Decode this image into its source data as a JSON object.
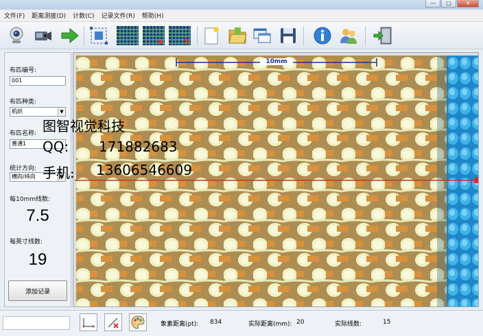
{
  "menu": [
    "文件(F)",
    "距离测度(D)",
    "计数(C)",
    "记录文件(R)",
    "帮助(H)"
  ],
  "window_buttons": {
    "minimize": "—",
    "maximize": "□",
    "close": "×"
  },
  "left": {
    "cloth_no_label": "布匹编号:",
    "cloth_no_value": "001",
    "cloth_type_label": "布匹种类:",
    "cloth_type_value": "机织",
    "cloth_name_label": "布匹名称:",
    "cloth_name_value": "普通1",
    "direction_label": "统计方向:",
    "direction_value": "横向/纬向",
    "per10mm_label": "每10mm线数:",
    "per10mm_value": "7.5",
    "perinch_label": "每英寸线数:",
    "perinch_value": "19",
    "add_record": "添加记录"
  },
  "image": {
    "scale_label": "10mm",
    "overlay_line1": "图智视觉科技",
    "overlay_line2_label": "QQ:",
    "overlay_line2_value": "171882683",
    "overlay_line3_label": "手机:",
    "overlay_line3_value": "13606546609"
  },
  "status": {
    "pixel_label": "象素距离(pt):",
    "pixel_value": "834",
    "real_label": "实际距离(mm):",
    "real_value": "20",
    "count_label": "实际线数:",
    "count_value": "15"
  },
  "colors": {
    "measure_line": "#c0392b",
    "scale_bar": "#1f2b8f",
    "yarn_weft": "#eef0bf",
    "yarn_warp": "#d8943f",
    "yarn_blue": "#2aa6e0"
  }
}
